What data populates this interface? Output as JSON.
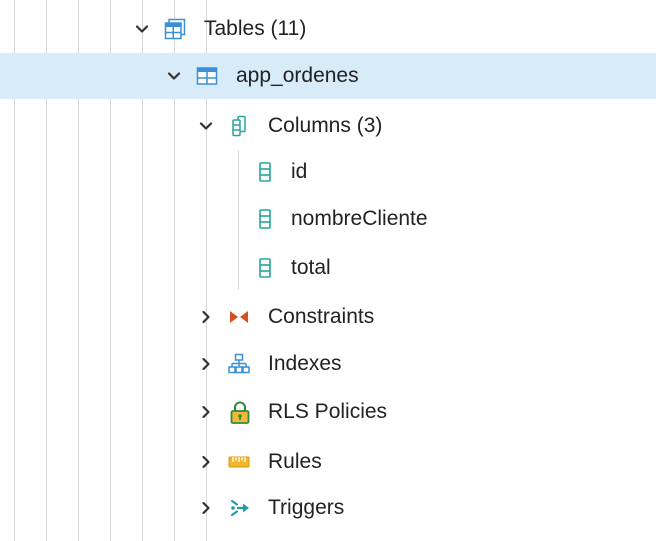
{
  "tree": {
    "tables": {
      "label": "Tables (11)",
      "expanded": true,
      "icon": "tables-icon"
    },
    "table": {
      "label": "app_ordenes",
      "expanded": true,
      "selected": true,
      "icon": "table-icon"
    },
    "columns": {
      "label": "Columns (3)",
      "expanded": true,
      "icon": "columns-icon",
      "items": [
        {
          "label": "id",
          "icon": "column-icon"
        },
        {
          "label": "nombreCliente",
          "icon": "column-icon"
        },
        {
          "label": "total",
          "icon": "column-icon"
        }
      ]
    },
    "constraints": {
      "label": "Constraints",
      "expanded": false,
      "icon": "constraints-icon"
    },
    "indexes": {
      "label": "Indexes",
      "expanded": false,
      "icon": "indexes-icon"
    },
    "rls_policies": {
      "label": "RLS Policies",
      "expanded": false,
      "icon": "lock-icon"
    },
    "rules": {
      "label": "Rules",
      "expanded": false,
      "icon": "rules-icon"
    },
    "triggers": {
      "label": "Triggers",
      "expanded": false,
      "icon": "triggers-icon"
    }
  },
  "colors": {
    "selected_row": "#d7ebf9",
    "table_icon": "#3a8fd6",
    "column_icon": "#26a69a",
    "constraint_icon": "#d4511f",
    "rules_icon": "#f2b72c",
    "lock_icon": "#2f8a3a"
  }
}
